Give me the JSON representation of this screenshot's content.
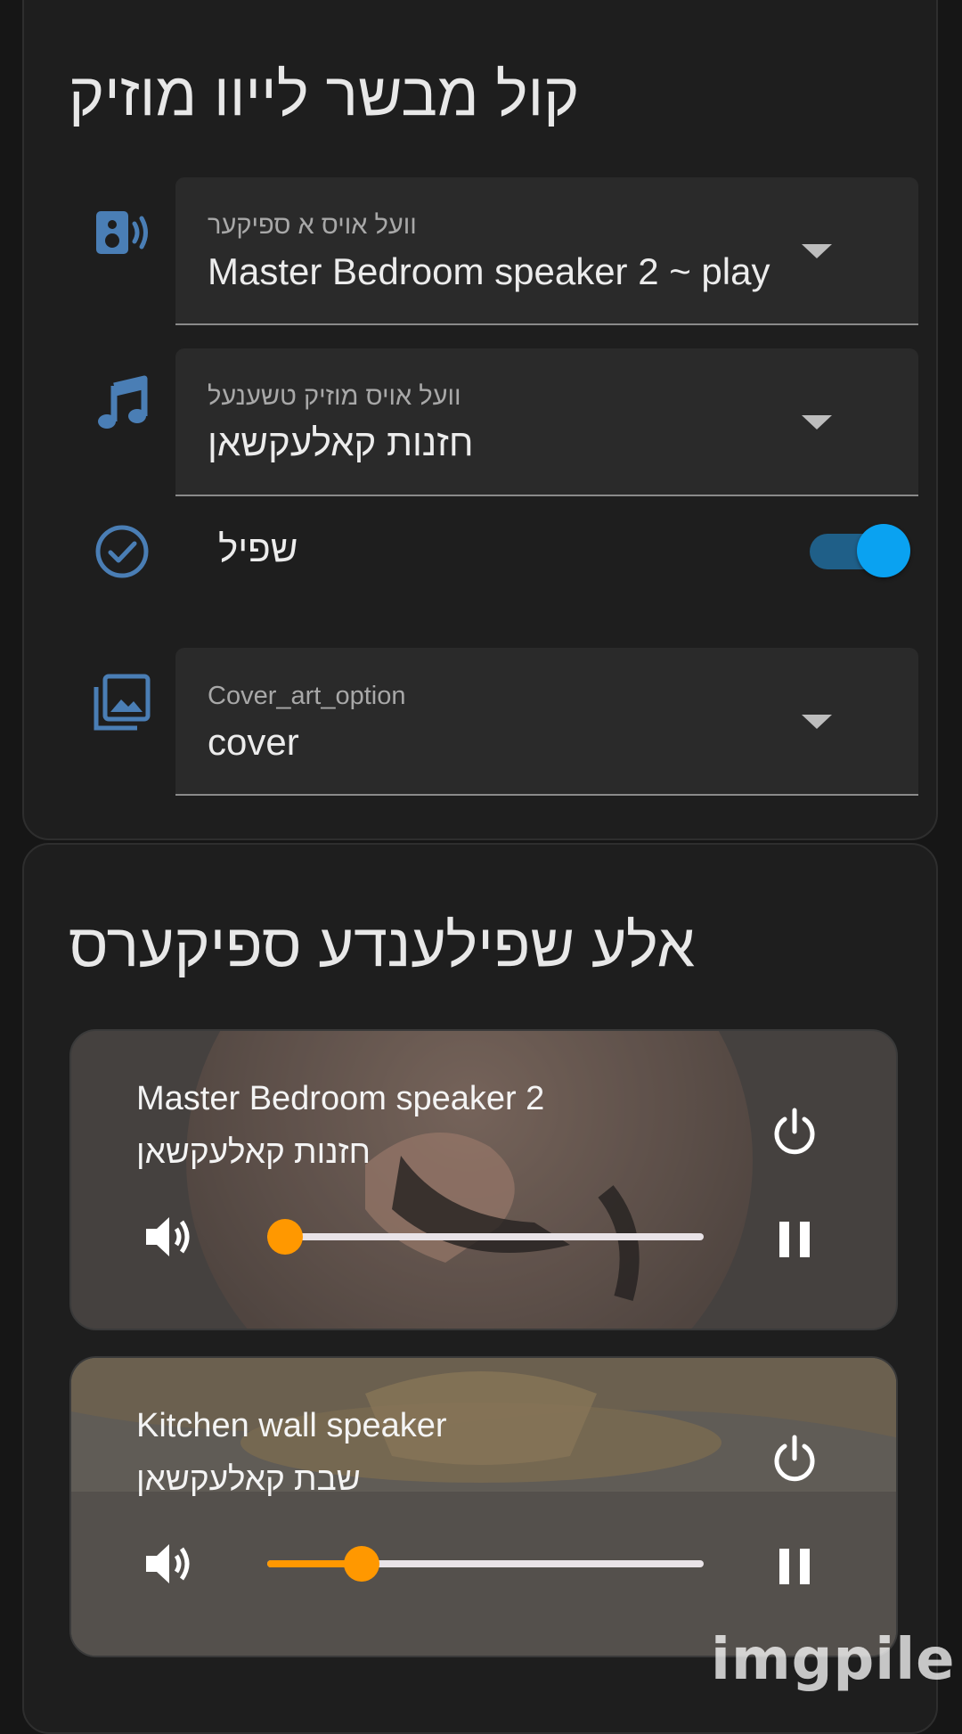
{
  "control_card": {
    "title": "קול מבשר לייוו מוזיק",
    "speaker_select": {
      "label": "וועל אויס א ספיקער",
      "value": "Master Bedroom speaker 2 ~ play",
      "icon": "speaker-icon"
    },
    "channel_select": {
      "label": "וועל אויס מוזיק טשענעל",
      "value": "חזנות קאלעקשאן",
      "icon": "music-note-icon"
    },
    "play_toggle": {
      "label": "שפיל",
      "on": true,
      "icon": "check-circle-icon"
    },
    "cover_select": {
      "label": "Cover_art_option",
      "value": "cover",
      "icon": "image-multiple-icon"
    }
  },
  "speakers_card": {
    "title": "אלע שפילענדע ספיקערס",
    "players": [
      {
        "name": "Master Bedroom speaker 2",
        "subtitle": "חזנות קאלעקשאן",
        "volume": 0.0,
        "state": "playing"
      },
      {
        "name": "Kitchen wall speaker",
        "subtitle": "שבת קאלעקשאן",
        "volume": 0.19,
        "state": "playing"
      }
    ]
  },
  "colors": {
    "accent": "#ff9800",
    "toggle_on": "#0aa2f1",
    "icon_blue": "#4a7eb5",
    "card_bg": "#1e1e1e"
  },
  "watermark": "imgpile"
}
